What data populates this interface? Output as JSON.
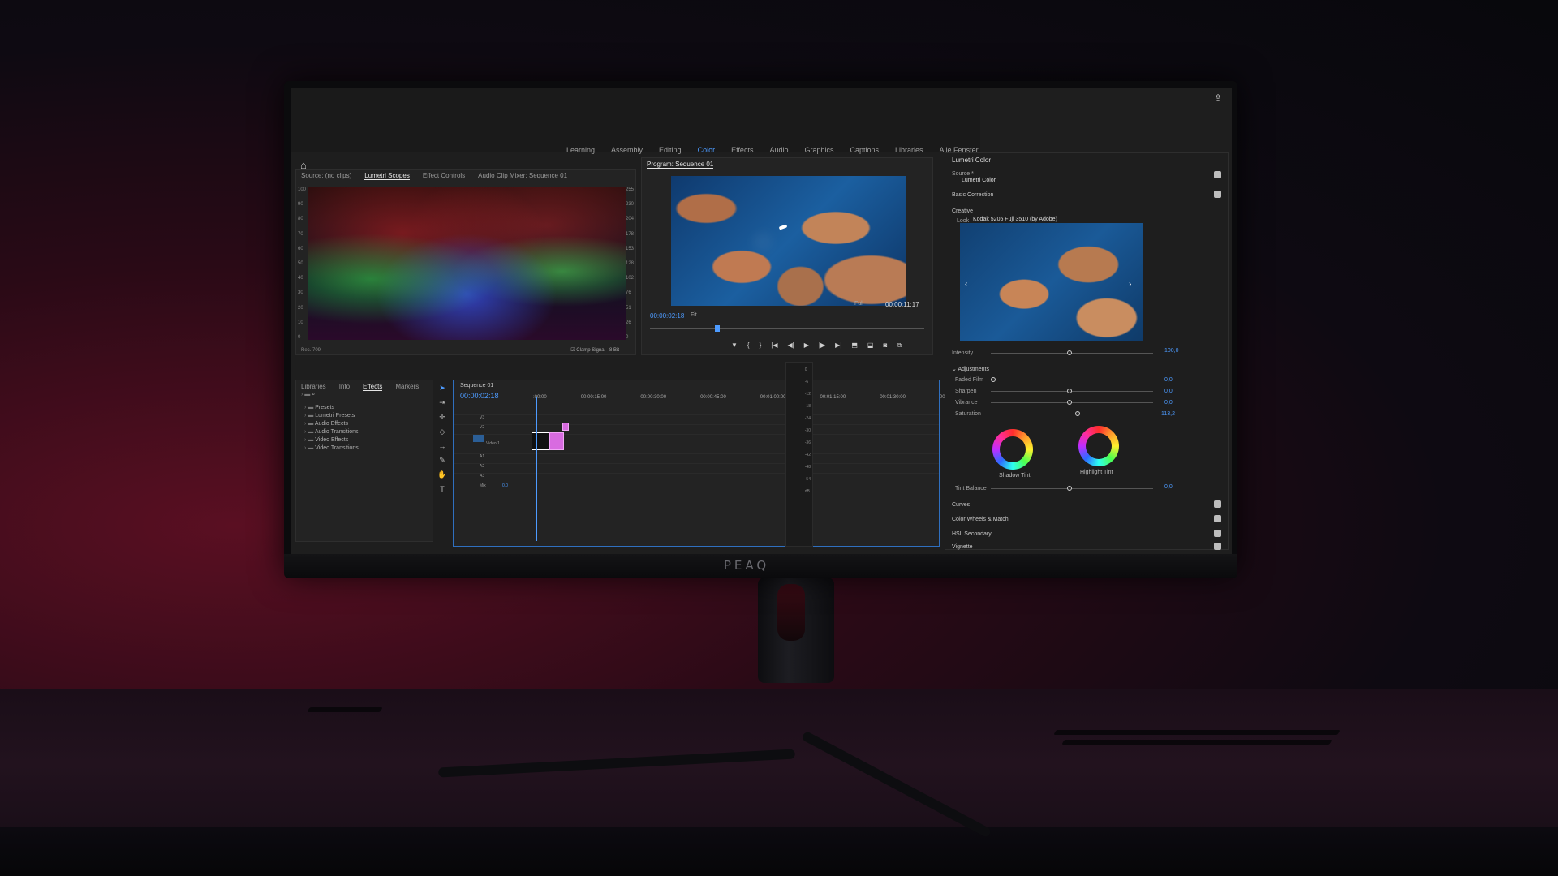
{
  "workspace_tabs": [
    "Learning",
    "Assembly",
    "Editing",
    "Color",
    "Effects",
    "Audio",
    "Graphics",
    "Captions",
    "Libraries",
    "Alle Fenster"
  ],
  "active_workspace": "Color",
  "source_panel": {
    "tabs": [
      "Source: (no clips)",
      "Lumetri Scopes",
      "Effect Controls",
      "Audio Clip Mixer: Sequence 01"
    ],
    "active_tab": "Lumetri Scopes",
    "scale_left": [
      "100",
      "90",
      "80",
      "70",
      "60",
      "50",
      "40",
      "30",
      "20",
      "10",
      "0"
    ],
    "scale_right": [
      "255",
      "230",
      "204",
      "178",
      "153",
      "128",
      "102",
      "76",
      "51",
      "26",
      "0"
    ],
    "footer": "Rec. 709",
    "clamp_label": "Clamp Signal",
    "bit_label": "8 Bit"
  },
  "program": {
    "title": "Program: Sequence 01",
    "timecode_current": "00:00:02:18",
    "timecode_total": "00:00:11:17",
    "fit_label": "Fit",
    "resolution_label": "Full"
  },
  "lumetri": {
    "title": "Lumetri Color",
    "source_label": "Source *",
    "source_value": "Lumetri Color",
    "basic_correction": "Basic Correction",
    "creative": "Creative",
    "look_label": "Look",
    "look_value": "Kodak 5205 Fuji 3510 (by Adobe)",
    "intensity_label": "Intensity",
    "intensity_value": "100,0",
    "adjustments": "Adjustments",
    "sliders": [
      {
        "label": "Faded Film",
        "value": "0,0"
      },
      {
        "label": "Sharpen",
        "value": "0,0"
      },
      {
        "label": "Vibrance",
        "value": "0,0"
      },
      {
        "label": "Saturation",
        "value": "113,2"
      }
    ],
    "shadow_tint": "Shadow Tint",
    "highlight_tint": "Highlight Tint",
    "tint_balance_label": "Tint Balance",
    "tint_balance_value": "0,0",
    "sections": [
      "Curves",
      "Color Wheels & Match",
      "HSL Secondary",
      "Vignette"
    ]
  },
  "effects_panel": {
    "tabs": [
      "Libraries",
      "Info",
      "Effects",
      "Markers"
    ],
    "active_tab": "Effects",
    "items": [
      "Presets",
      "Lumetri Presets",
      "Audio Effects",
      "Audio Transitions",
      "Video Effects",
      "Video Transitions"
    ]
  },
  "timeline": {
    "title": "Sequence 01",
    "timecode": "00:00:02:18",
    "ruler": [
      ":00:00",
      "00:00:15:00",
      "00:00:30:00",
      "00:00:45:00",
      "00:01:00:00",
      "00:01:15:00",
      "00:01:30:00",
      "00"
    ],
    "tracks": [
      "V3",
      "V2",
      "V1",
      "A1",
      "A2",
      "A3",
      "Mix"
    ],
    "video1_label": "Video 1",
    "mix_value": "0,0"
  },
  "brand": "PEAQ",
  "colors": {
    "accent": "#4d9bff",
    "clip": "#d86be0",
    "panel": "#232323"
  }
}
